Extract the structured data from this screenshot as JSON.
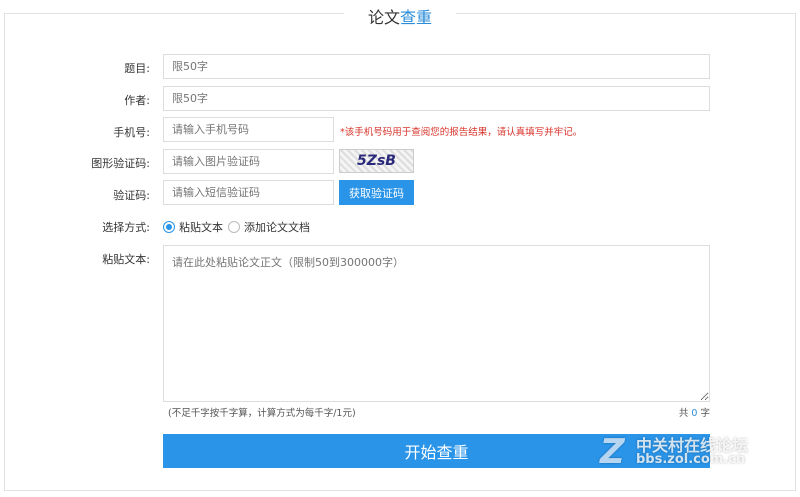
{
  "title": {
    "part1": "论文",
    "part2": "查重"
  },
  "form": {
    "title_label": "题目:",
    "title_placeholder": "限50字",
    "author_label": "作者:",
    "author_placeholder": "限50字",
    "phone_label": "手机号:",
    "phone_placeholder": "请输入手机号码",
    "phone_note": "*该手机号码用于查阅您的报告结果，请认真填写并牢记。",
    "captcha_label": "图形验证码:",
    "captcha_placeholder": "请输入图片验证码",
    "captcha_text": "5ZsB",
    "sms_label": "验证码:",
    "sms_placeholder": "请输入短信验证码",
    "sms_button": "获取验证码",
    "method_label": "选择方式:",
    "method_options": [
      "粘贴文本",
      "添加论文文档"
    ],
    "method_selected": "粘贴文本",
    "paste_label": "粘贴文本:",
    "paste_placeholder": "请在此处粘贴论文正文（限制50到300000字）",
    "pricing_note": "(不足千字按千字算，计算方式为每千字/1元)",
    "count_prefix": "共",
    "count_value": "0",
    "count_suffix": "字",
    "submit": "开始查重"
  },
  "watermark": {
    "name": "中关村在线论坛",
    "url": "bbs.zol.com.cn"
  },
  "colors": {
    "accent": "#2a94e8",
    "warning": "#d9342b"
  }
}
